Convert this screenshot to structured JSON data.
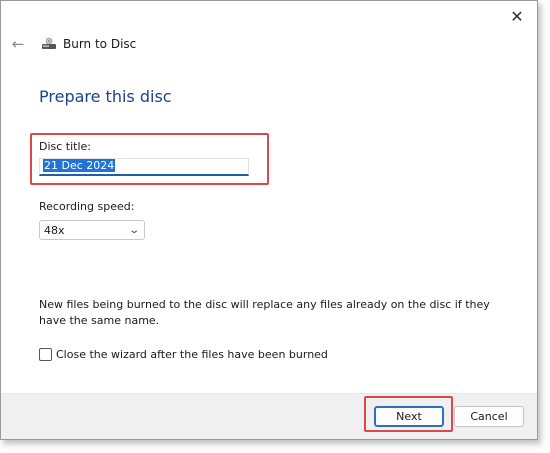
{
  "window": {
    "title": "Burn to Disc",
    "close_glyph": "✕",
    "back_glyph": "←"
  },
  "page": {
    "heading": "Prepare this disc",
    "disc_title_label": "Disc title:",
    "disc_title_value": "21 Dec 2024",
    "recording_speed_label": "Recording speed:",
    "recording_speed_value": "48x",
    "info_text": "New files being burned to the disc will replace any files already on the disc if they have the same name.",
    "close_wizard_label": "Close the wizard after the files have been burned",
    "close_wizard_checked": false
  },
  "footer": {
    "next_label": "Next",
    "cancel_label": "Cancel"
  },
  "colors": {
    "heading": "#1f3f8f",
    "highlight_box": "#e0474c",
    "selection": "#1f73d9",
    "primary_button_border": "#2a6fc9"
  },
  "icons": {
    "back": "back-arrow-icon",
    "burn": "disc-burner-icon",
    "close": "close-icon",
    "dropdown": "chevron-down-icon"
  }
}
